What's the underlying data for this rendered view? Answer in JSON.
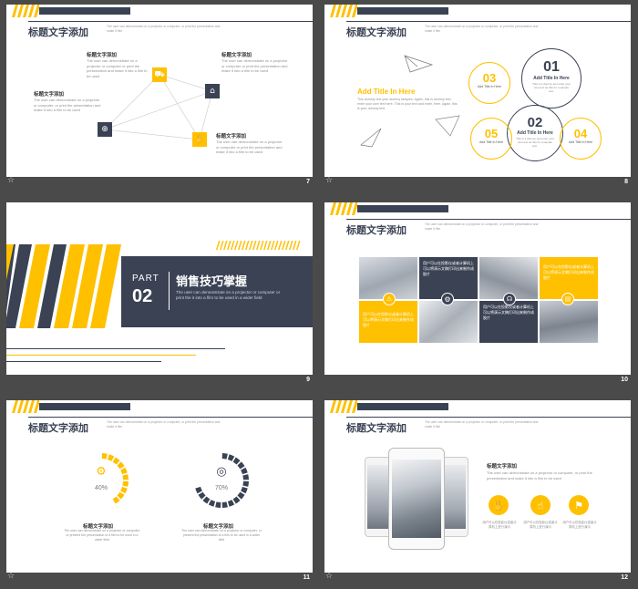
{
  "colors": {
    "accent": "#ffc000",
    "dark": "#3a4254",
    "background": "#4a4a4a"
  },
  "common": {
    "header_title": "标题文字添加",
    "header_sub": "The user can demonstrate on a projector or computer, or print the presentation and make it film",
    "footer_icon": "star-icon"
  },
  "slide7": {
    "page": "7",
    "items": [
      {
        "title": "标题文字添加",
        "text": "The user can demonstrate on a projector or computer or print the presentation and make it into a film to be used"
      },
      {
        "title": "标题文字添加",
        "text": "The user can demonstrate on a projector or computer or print the presentation and make it into a film to be used"
      },
      {
        "title": "标题文字添加",
        "text": "The user can demonstrate on a projector or computer, or print the presentation and make it into a film to be used"
      },
      {
        "title": "标题文字添加",
        "text": "The user can demonstrate on a projector or computer or print the presentation and make it into a film to be used"
      }
    ],
    "icons": [
      "cart-icon",
      "shop-icon",
      "globe-icon",
      "hand-coin-icon"
    ]
  },
  "slide8": {
    "page": "8",
    "add_title": "Add Title In Here",
    "body": "This dummy text your dummy tamples. Again, this is dummy text, enter your own text here. This is your text and enter, here. Again, this is your dummy text.",
    "circles": [
      {
        "num": "03",
        "label": "Add Title In Here"
      },
      {
        "num": "01",
        "label": "Add Title In Here",
        "text": "This is a dummy text enter your own text as this for a sample text."
      },
      {
        "num": "02",
        "label": "Add Title In Here",
        "text": "This is a dummy text enter your own text as this for a sample text."
      },
      {
        "num": "05",
        "label": "Add Title In Here"
      },
      {
        "num": "04",
        "label": "Add Title In Here"
      }
    ]
  },
  "slide9": {
    "page": "9",
    "part": "PART",
    "part_num": "02",
    "title": "销售技巧掌握",
    "text": "The user can demonstrate on a projector or computer or print the it into a film to be used in a wider field"
  },
  "slide10": {
    "page": "10",
    "tiles": [
      "用户可以在投影仪或者计算机上可以将演示文稿打印出来制作成胶片",
      "用户可以在投影仪或者计算机上可以将演示文稿打印出来制作成胶片",
      "用户可以在投影仪或者计算机上可以将演示文稿打印出来制作成胶片",
      "用户可以在投影仪或者计算机上可以将演示文稿打印出来制作成胶片"
    ]
  },
  "slide11": {
    "page": "11",
    "rings": [
      {
        "value": "40%",
        "fraction": 0.4,
        "title": "标题文字添加",
        "text": "The user can demonstrate on a projector or computer, or present the presentation of a film to be used in a wider field"
      },
      {
        "value": "70%",
        "fraction": 0.7,
        "title": "标题文字添加",
        "text": "The user can demonstrate on a projector or computer, or present the presentation of a film to be used in a wider field"
      }
    ]
  },
  "slide12": {
    "page": "12",
    "title": "标题文字添加",
    "text": "The user can demonstrate on a projector or computer, or print the presentation and make it into a film to be used",
    "features": [
      {
        "icon": "handshake-icon",
        "text": "用户可以在投影仪或者计算机上进行演示"
      },
      {
        "icon": "hand-icon",
        "text": "用户可以在投影仪或者计算机上进行演示"
      },
      {
        "icon": "runner-icon",
        "text": "用户可以在投影仪或者计算机上进行演示"
      }
    ]
  }
}
